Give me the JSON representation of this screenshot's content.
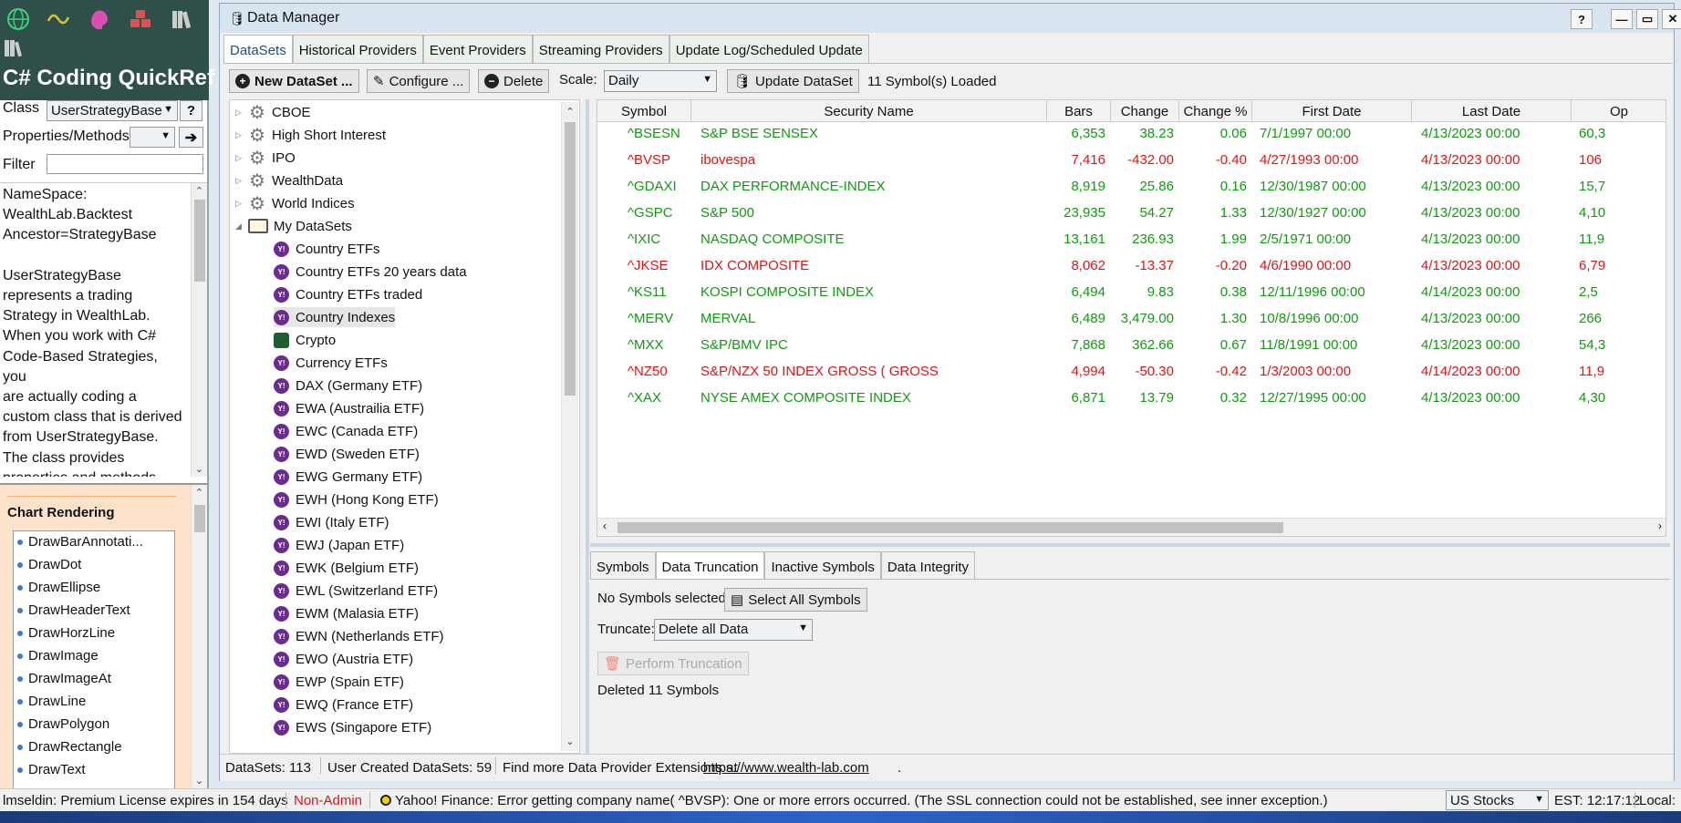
{
  "left_panel": {
    "toolbar_icons": [
      "globe-icon",
      "wave-icon",
      "brain-icon",
      "cubes-icon",
      "books-icon"
    ],
    "library_icon": "library-icon",
    "title": "C# Coding QuickRef",
    "class_label": "Class",
    "class_value": "UserStrategyBase",
    "help_btn": "?",
    "props_label": "Properties/Methods",
    "filter_label": "Filter",
    "namespace_text": "NameSpace:\nWealthLab.Backtest\nAncestor=StrategyBase\n\nUserStrategyBase\nrepresents a trading\nStrategy in WealthLab.\nWhen you work with C#\nCode-Based Strategies, you\nare actually coding a\ncustom class that is derived\nfrom UserStrategyBase.\nThe class provides\nproperties and methods\nthat let you control the",
    "chart_section_title": "Chart Rendering",
    "draw_items": [
      "DrawBarAnnotati...",
      "DrawDot",
      "DrawEllipse",
      "DrawHeaderText",
      "DrawHorzLine",
      "DrawImage",
      "DrawImageAt",
      "DrawLine",
      "DrawPolygon",
      "DrawRectangle",
      "DrawText"
    ]
  },
  "window": {
    "title": "Data Manager",
    "controls": [
      "?",
      "—",
      "▭",
      "✕"
    ],
    "tabs": [
      "DataSets",
      "Historical Providers",
      "Event Providers",
      "Streaming Providers",
      "Update Log/Scheduled Update"
    ],
    "toolbar": {
      "new_dataset": "New DataSet ...",
      "configure": "Configure ...",
      "delete": "Delete",
      "scale_label": "Scale:",
      "scale_value": "Daily",
      "update_dataset": "Update DataSet",
      "loaded": "11 Symbol(s) Loaded"
    }
  },
  "tree": [
    {
      "label": "CBOE",
      "type": "gear",
      "level": 0,
      "expand": "▷"
    },
    {
      "label": "High Short Interest",
      "type": "gear",
      "level": 0,
      "expand": "▷"
    },
    {
      "label": "IPO",
      "type": "gear",
      "level": 0,
      "expand": "▷"
    },
    {
      "label": "WealthData",
      "type": "gear",
      "level": 0,
      "expand": "▷"
    },
    {
      "label": "World Indices",
      "type": "gear",
      "level": 0,
      "expand": "▷"
    },
    {
      "label": "My DataSets",
      "type": "folder",
      "level": 0,
      "expand": "◢"
    },
    {
      "label": "Country ETFs",
      "type": "y",
      "level": 1
    },
    {
      "label": "Country ETFs 20 years data",
      "type": "y",
      "level": 1
    },
    {
      "label": "Country ETFs traded",
      "type": "y",
      "level": 1
    },
    {
      "label": "Country Indexes",
      "type": "y",
      "level": 1,
      "selected": true
    },
    {
      "label": "Crypto",
      "type": "crypto",
      "level": 1
    },
    {
      "label": "Currency ETFs",
      "type": "y",
      "level": 1
    },
    {
      "label": "DAX (Germany ETF)",
      "type": "y",
      "level": 1
    },
    {
      "label": "EWA (Austrailia ETF)",
      "type": "y",
      "level": 1
    },
    {
      "label": "EWC (Canada  ETF)",
      "type": "y",
      "level": 1
    },
    {
      "label": "EWD (Sweden ETF)",
      "type": "y",
      "level": 1
    },
    {
      "label": "EWG Germany ETF)",
      "type": "y",
      "level": 1
    },
    {
      "label": "EWH (Hong Kong ETF)",
      "type": "y",
      "level": 1
    },
    {
      "label": "EWI (Italy ETF)",
      "type": "y",
      "level": 1
    },
    {
      "label": "EWJ (Japan ETF)",
      "type": "y",
      "level": 1
    },
    {
      "label": "EWK (Belgium ETF)",
      "type": "y",
      "level": 1
    },
    {
      "label": "EWL (Switzerland ETF)",
      "type": "y",
      "level": 1
    },
    {
      "label": "EWM (Malasia ETF)",
      "type": "y",
      "level": 1
    },
    {
      "label": "EWN (Netherlands ETF)",
      "type": "y",
      "level": 1
    },
    {
      "label": "EWO (Austria ETF)",
      "type": "y",
      "level": 1
    },
    {
      "label": "EWP (Spain ETF)",
      "type": "y",
      "level": 1
    },
    {
      "label": "EWQ (France ETF)",
      "type": "y",
      "level": 1
    },
    {
      "label": "EWS (Singapore ETF)",
      "type": "y",
      "level": 1
    }
  ],
  "grid": {
    "columns": [
      "Symbol",
      "Security Name",
      "Bars",
      "Change",
      "Change %",
      "First Date",
      "Last Date",
      "Op"
    ],
    "rows": [
      {
        "symbol": "^BSESN",
        "name": "S&P BSE SENSEX",
        "bars": "6,353",
        "change": "38.23",
        "pct": "0.06",
        "first": "7/1/1997 00:00",
        "last": "4/13/2023 00:00",
        "op": "60,3",
        "color": "green"
      },
      {
        "symbol": "^BVSP",
        "name": "ibovespa",
        "bars": "7,416",
        "change": "-432.00",
        "pct": "-0.40",
        "first": "4/27/1993 00:00",
        "last": "4/13/2023 00:00",
        "op": "106",
        "color": "red"
      },
      {
        "symbol": "^GDAXI",
        "name": "DAX PERFORMANCE-INDEX",
        "bars": "8,919",
        "change": "25.86",
        "pct": "0.16",
        "first": "12/30/1987 00:00",
        "last": "4/13/2023 00:00",
        "op": "15,7",
        "color": "green"
      },
      {
        "symbol": "^GSPC",
        "name": "S&P 500",
        "bars": "23,935",
        "change": "54.27",
        "pct": "1.33",
        "first": "12/30/1927 00:00",
        "last": "4/13/2023 00:00",
        "op": "4,10",
        "color": "green"
      },
      {
        "symbol": "^IXIC",
        "name": "NASDAQ COMPOSITE",
        "bars": "13,161",
        "change": "236.93",
        "pct": "1.99",
        "first": "2/5/1971 00:00",
        "last": "4/13/2023 00:00",
        "op": "11,9",
        "color": "green"
      },
      {
        "symbol": "^JKSE",
        "name": "IDX COMPOSITE",
        "bars": "8,062",
        "change": "-13.37",
        "pct": "-0.20",
        "first": "4/6/1990 00:00",
        "last": "4/13/2023 00:00",
        "op": "6,79",
        "color": "red"
      },
      {
        "symbol": "^KS11",
        "name": "KOSPI COMPOSITE INDEX",
        "bars": "6,494",
        "change": "9.83",
        "pct": "0.38",
        "first": "12/11/1996 00:00",
        "last": "4/14/2023 00:00",
        "op": "2,5",
        "color": "green"
      },
      {
        "symbol": "^MERV",
        "name": "MERVAL",
        "bars": "6,489",
        "change": "3,479.00",
        "pct": "1.30",
        "first": "10/8/1996 00:00",
        "last": "4/13/2023 00:00",
        "op": "266",
        "color": "green"
      },
      {
        "symbol": "^MXX",
        "name": "S&P/BMV IPC",
        "bars": "7,868",
        "change": "362.66",
        "pct": "0.67",
        "first": "11/8/1991 00:00",
        "last": "4/13/2023 00:00",
        "op": "54,3",
        "color": "green"
      },
      {
        "symbol": "^NZ50",
        "name": "S&P/NZX 50 INDEX GROSS ( GROSS",
        "bars": "4,994",
        "change": "-50.30",
        "pct": "-0.42",
        "first": "1/3/2003 00:00",
        "last": "4/14/2023 00:00",
        "op": "11,9",
        "color": "red"
      },
      {
        "symbol": "^XAX",
        "name": "NYSE AMEX COMPOSITE INDEX",
        "bars": "6,871",
        "change": "13.79",
        "pct": "0.32",
        "first": "12/27/1995 00:00",
        "last": "4/13/2023 00:00",
        "op": "4,30",
        "color": "green"
      }
    ]
  },
  "bottom": {
    "tabs": [
      "Symbols",
      "Data Truncation",
      "Inactive Symbols",
      "Data Integrity"
    ],
    "no_symbols": "No Symbols selected ...",
    "select_all": "Select All Symbols",
    "truncate_label": "Truncate:",
    "truncate_value": "Delete all Data",
    "perform": "Perform Truncation",
    "result": "Deleted 11 Symbols"
  },
  "status": {
    "datasets": "DataSets: 113",
    "user_created": "User Created DataSets: 59",
    "find_more": "Find more Data Provider Extensions at",
    "link": "https://www.wealth-lab.com",
    "period": "."
  },
  "app_status": {
    "license": "lmseldin: Premium License expires in 154 days",
    "non_admin": "Non-Admin",
    "message": "Yahoo! Finance: Error getting company name( ^BVSP): One or more errors occurred. (The SSL connection could not be established, see inner exception.)",
    "market": "US Stocks",
    "time": "EST: 12:17:12",
    "local": "Local:"
  },
  "colors": {
    "accent_green": "#109a10",
    "accent_red": "#e01414",
    "yahoo_purple": "#6a2c8e",
    "panel_dark": "#2f4f4a"
  }
}
